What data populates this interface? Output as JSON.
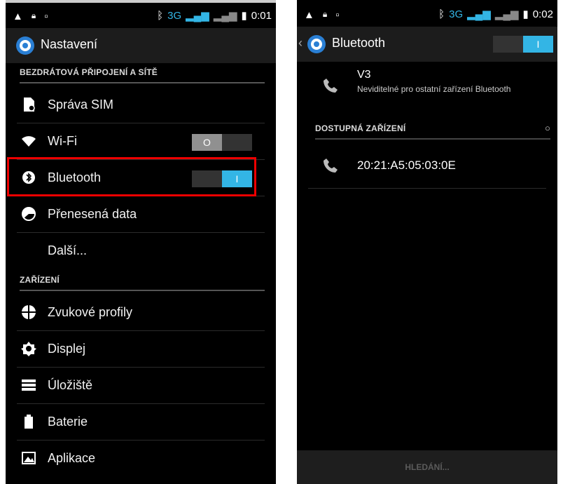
{
  "left": {
    "status": {
      "network": "3G",
      "time": "0:01"
    },
    "title": "Nastavení",
    "section_wireless": "BEZDRÁTOVÁ PŘIPOJENÍ A SÍTĚ",
    "section_device": "ZAŘÍZENÍ",
    "items": {
      "sim": "Správa SIM",
      "wifi": "Wi-Fi",
      "bluetooth": "Bluetooth",
      "data": "Přenesená data",
      "more": "Další...",
      "sound": "Zvukové profily",
      "display": "Displej",
      "storage": "Úložiště",
      "battery": "Baterie",
      "apps": "Aplikace"
    },
    "wifi_toggle": "O",
    "bt_toggle": "I"
  },
  "right": {
    "status": {
      "network": "3G",
      "time": "0:02"
    },
    "title": "Bluetooth",
    "toggle": "I",
    "device": {
      "name": "V3",
      "subtitle": "Neviditelné pro ostatní zařízení Bluetooth"
    },
    "section_available": "DOSTUPNÁ ZAŘÍZENÍ",
    "available_device": "20:21:A5:05:03:0E",
    "search_button": "HLEDÁNÍ..."
  },
  "colors": {
    "accent": "#33b5e5",
    "highlight": "#e00000"
  }
}
